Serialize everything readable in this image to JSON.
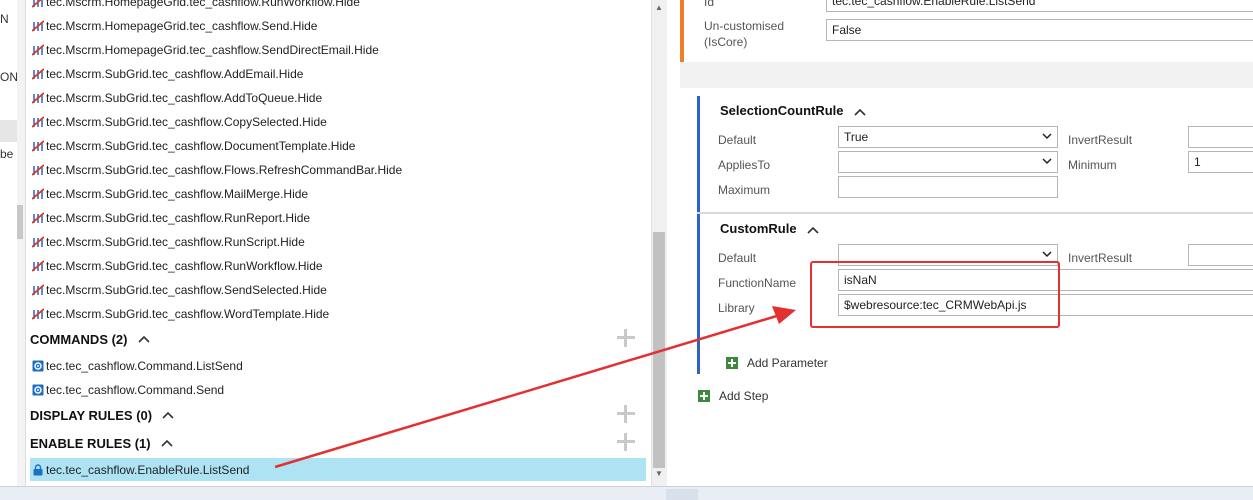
{
  "left_strip": {
    "fragment_1": "N",
    "fragment_2": "ON",
    "fragment_3": "be"
  },
  "tree": {
    "hide_rules": [
      "tec.Mscrm.HomepageGrid.tec_cashflow.RunWorkflow.Hide",
      "tec.Mscrm.HomepageGrid.tec_cashflow.Send.Hide",
      "tec.Mscrm.HomepageGrid.tec_cashflow.SendDirectEmail.Hide",
      "tec.Mscrm.SubGrid.tec_cashflow.AddEmail.Hide",
      "tec.Mscrm.SubGrid.tec_cashflow.AddToQueue.Hide",
      "tec.Mscrm.SubGrid.tec_cashflow.CopySelected.Hide",
      "tec.Mscrm.SubGrid.tec_cashflow.DocumentTemplate.Hide",
      "tec.Mscrm.SubGrid.tec_cashflow.Flows.RefreshCommandBar.Hide",
      "tec.Mscrm.SubGrid.tec_cashflow.MailMerge.Hide",
      "tec.Mscrm.SubGrid.tec_cashflow.RunReport.Hide",
      "tec.Mscrm.SubGrid.tec_cashflow.RunScript.Hide",
      "tec.Mscrm.SubGrid.tec_cashflow.RunWorkflow.Hide",
      "tec.Mscrm.SubGrid.tec_cashflow.SendSelected.Hide",
      "tec.Mscrm.SubGrid.tec_cashflow.WordTemplate.Hide"
    ],
    "commands": {
      "title": "COMMANDS (2)",
      "items": [
        "tec.tec_cashflow.Command.ListSend",
        "tec.tec_cashflow.Command.Send"
      ]
    },
    "display_rules": {
      "title": "DISPLAY RULES (0)"
    },
    "enable_rules": {
      "title": "ENABLE RULES (1)",
      "items": [
        "tec.tec_cashflow.EnableRule.ListSend"
      ]
    }
  },
  "properties": {
    "id_label": "Id",
    "id_value": "tec.tec_cashflow.EnableRule.ListSend",
    "uncustomised_label": "Un-customised (IsCore)",
    "uncustomised_value": "False",
    "selection_count_rule": {
      "title": "SelectionCountRule",
      "default_label": "Default",
      "default_value": "True",
      "invert_label": "InvertResult",
      "invert_value": "",
      "applies_to_label": "AppliesTo",
      "applies_to_value": "",
      "minimum_label": "Minimum",
      "minimum_value": "1",
      "maximum_label": "Maximum",
      "maximum_value": ""
    },
    "custom_rule": {
      "title": "CustomRule",
      "default_label": "Default",
      "default_value": "",
      "invert_label": "InvertResult",
      "invert_value": "",
      "function_label": "FunctionName",
      "function_value": "isNaN",
      "library_label": "Library",
      "library_value": "$webresource:tec_CRMWebApi.js",
      "add_parameter": "Add Parameter"
    },
    "add_step": "Add Step"
  },
  "colors": {
    "accent_orange": "#f07d2a",
    "card_blue": "#2b63c6",
    "selection": "#aee3f4",
    "annotation_red": "#e33030",
    "add_green": "#3c8a3c"
  }
}
